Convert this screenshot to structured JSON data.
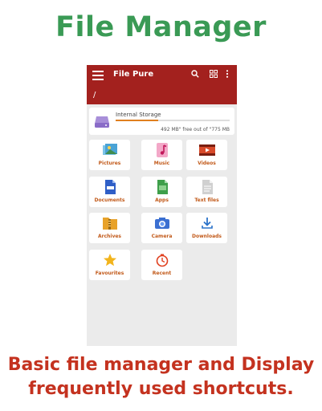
{
  "headline": "File Manager",
  "app": {
    "title": "File Pure",
    "path": "/",
    "bar_color": "#a3211e"
  },
  "storage": {
    "name": "Internal Storage",
    "free_text": "492 MB\" free out of \"775 MB",
    "used_fraction": 0.37
  },
  "tiles": [
    {
      "label": "Pictures",
      "icon": "pictures-icon"
    },
    {
      "label": "Music",
      "icon": "music-icon"
    },
    {
      "label": "Videos",
      "icon": "videos-icon"
    },
    {
      "label": "Documents",
      "icon": "documents-icon"
    },
    {
      "label": "Apps",
      "icon": "apps-icon"
    },
    {
      "label": "Text files",
      "icon": "text-files-icon"
    },
    {
      "label": "Archives",
      "icon": "archives-icon"
    },
    {
      "label": "Camera",
      "icon": "camera-icon"
    },
    {
      "label": "Downloads",
      "icon": "downloads-icon"
    },
    {
      "label": "Favourites",
      "icon": "favourites-icon"
    },
    {
      "label": "Recent",
      "icon": "recent-icon"
    }
  ],
  "caption_line1": "Basic file manager and Display",
  "caption_line2": "frequently used shortcuts."
}
